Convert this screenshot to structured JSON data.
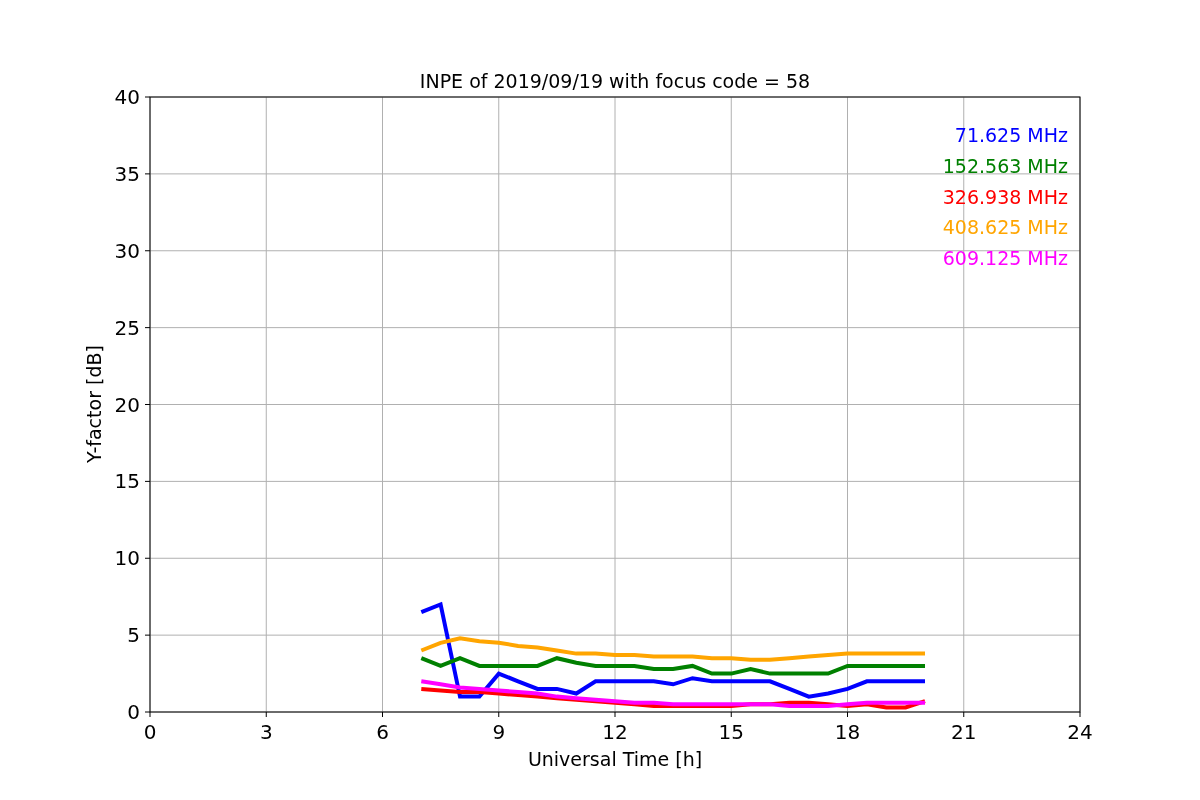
{
  "chart_data": {
    "type": "line",
    "title": "INPE of 2019/09/19 with focus code = 58",
    "xlabel": "Universal Time [h]",
    "ylabel": "Y-factor [dB]",
    "x": [
      7,
      7.5,
      8,
      8.5,
      9,
      9.5,
      10,
      10.5,
      11,
      11.5,
      12,
      12.5,
      13,
      13.5,
      14,
      14.5,
      15,
      15.5,
      16,
      16.5,
      17,
      17.5,
      18,
      18.5,
      19,
      19.5,
      20
    ],
    "series": [
      {
        "name": "71.625 MHz",
        "color": "#0000ff",
        "values": [
          6.5,
          7,
          1,
          1,
          2.5,
          2,
          1.5,
          1.5,
          1.2,
          2,
          2,
          2,
          2,
          1.8,
          2.2,
          2,
          2,
          2,
          2,
          1.5,
          1,
          1.2,
          1.5,
          2,
          2,
          2,
          2
        ]
      },
      {
        "name": "152.563 MHz",
        "color": "#008000",
        "values": [
          3.5,
          3,
          3.5,
          3,
          3,
          3,
          3,
          3.5,
          3.2,
          3,
          3,
          3,
          2.8,
          2.8,
          3,
          2.5,
          2.5,
          2.8,
          2.5,
          2.5,
          2.5,
          2.5,
          3,
          3,
          3,
          3,
          3
        ]
      },
      {
        "name": "326.938 MHz",
        "color": "#ff0000",
        "values": [
          1.5,
          1.4,
          1.3,
          1.3,
          1.2,
          1.1,
          1,
          0.9,
          0.8,
          0.7,
          0.6,
          0.5,
          0.4,
          0.4,
          0.4,
          0.4,
          0.4,
          0.5,
          0.5,
          0.6,
          0.6,
          0.5,
          0.4,
          0.5,
          0.3,
          0.3,
          0.7
        ]
      },
      {
        "name": "408.625 MHz",
        "color": "#ffa500",
        "values": [
          4,
          4.5,
          4.8,
          4.6,
          4.5,
          4.3,
          4.2,
          4,
          3.8,
          3.8,
          3.7,
          3.7,
          3.6,
          3.6,
          3.6,
          3.5,
          3.5,
          3.4,
          3.4,
          3.5,
          3.6,
          3.7,
          3.8,
          3.8,
          3.8,
          3.8,
          3.8
        ]
      },
      {
        "name": "609.125 MHz",
        "color": "#ff00ff",
        "values": [
          2,
          1.8,
          1.6,
          1.5,
          1.4,
          1.3,
          1.2,
          1,
          0.9,
          0.8,
          0.7,
          0.6,
          0.6,
          0.5,
          0.5,
          0.5,
          0.5,
          0.5,
          0.5,
          0.4,
          0.4,
          0.4,
          0.5,
          0.6,
          0.6,
          0.6,
          0.6
        ]
      }
    ],
    "grid": true,
    "xlim": [
      0,
      24
    ],
    "ylim": [
      0,
      40
    ],
    "xticks": [
      0,
      3,
      6,
      9,
      12,
      15,
      18,
      21,
      24
    ],
    "yticks": [
      0,
      5,
      10,
      15,
      20,
      25,
      30,
      35,
      40
    ]
  }
}
